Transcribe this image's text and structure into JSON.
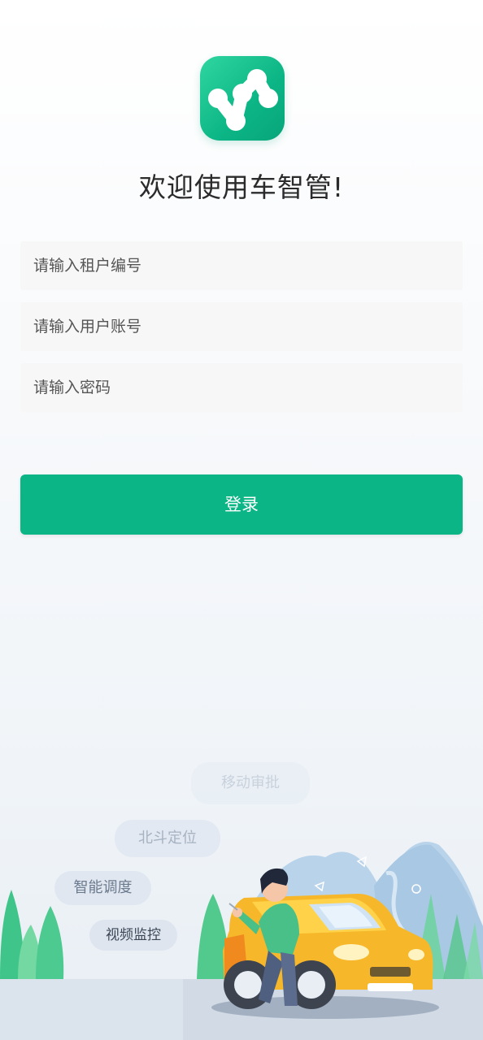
{
  "app": {
    "welcome": "欢迎使用车智管!"
  },
  "form": {
    "tenant_placeholder": "请输入租户编号",
    "account_placeholder": "请输入用户账号",
    "password_placeholder": "请输入密码",
    "login_label": "登录"
  },
  "features": [
    "移动审批",
    "北斗定位",
    "智能调度",
    "视频监控"
  ],
  "colors": {
    "primary": "#0bb585",
    "car": "#f6b82a"
  }
}
